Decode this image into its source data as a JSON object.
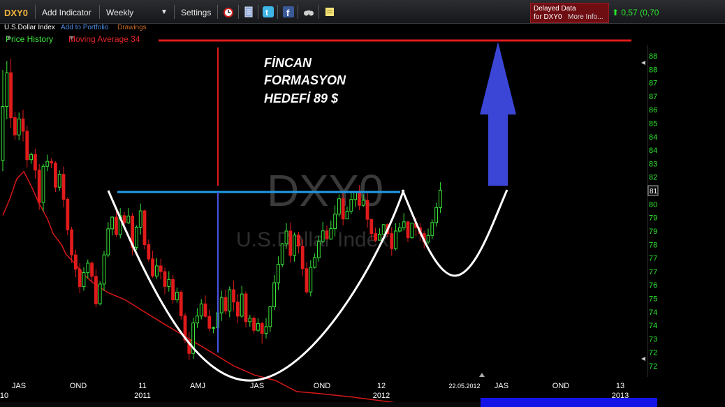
{
  "toolbar": {
    "symbol": "DXY0",
    "add_indicator": "Add Indicator",
    "period": "Weekly",
    "settings": "Settings",
    "delayed_line1": "Delayed Data",
    "delayed_line2": "for DXY0",
    "more_info": "More Info...",
    "price_change": "0,57 (0,70",
    "icons": [
      "alarm-clock-icon",
      "document-icon",
      "twitter-icon",
      "facebook-icon",
      "binoculars-icon",
      "note-icon"
    ]
  },
  "subbar": {
    "name": "U.S.Dollar Index",
    "add_to_portfolio": "Add to Portfolio",
    "drawings": "Drawings"
  },
  "legend": {
    "price_history": "Price History",
    "moving_average": "Moving Average 34"
  },
  "colors": {
    "up_candle": "#39e639",
    "down_candle": "#e01b1b",
    "moving_average": "#d81818",
    "annotation_blue": "#1e9ce8",
    "target_arrow": "#3b46d6",
    "target_line": "#e01b1b"
  },
  "annotation": {
    "line1": "FİNCAN",
    "line2": "FORMASYON",
    "line3": "HEDEFİ 89 $"
  },
  "watermark": {
    "symbol": "DXY0",
    "name": "U.S.Dollar Index"
  },
  "chart_data": {
    "type": "candlestick",
    "period": "weekly",
    "title": "",
    "y_ticks": [
      "88",
      "88",
      "87",
      "87",
      "86",
      "85",
      "84",
      "84",
      "83",
      "82",
      "81",
      "80",
      "79",
      "79",
      "78",
      "77",
      "77",
      "76",
      "75",
      "74",
      "74",
      "73",
      "72",
      "72"
    ],
    "current_value_label": "81",
    "x_ticks": [
      {
        "top": "JAS",
        "bottom": "10"
      },
      {
        "top": "OND",
        "bottom": ""
      },
      {
        "top": "11",
        "bottom": "2011"
      },
      {
        "top": "AMJ",
        "bottom": ""
      },
      {
        "top": "JAS",
        "bottom": ""
      },
      {
        "top": "OND",
        "bottom": ""
      },
      {
        "top": "12",
        "bottom": "2012"
      },
      {
        "top": "22.05.2012",
        "bottom": ""
      },
      {
        "top": "JAS",
        "bottom": ""
      },
      {
        "top": "OND",
        "bottom": ""
      },
      {
        "top": "13",
        "bottom": "2013"
      }
    ],
    "ylim": [
      71.6,
      88.8
    ],
    "grid": false,
    "candles": [
      [
        83.1,
        86.04,
        88.04,
        82.51
      ],
      [
        86.04,
        87.88,
        88.52,
        85.35
      ],
      [
        87.88,
        85.43,
        88.65,
        84.89
      ],
      [
        85.43,
        84.49,
        85.75,
        84.23
      ],
      [
        84.49,
        85.36,
        85.71,
        84.2
      ],
      [
        85.36,
        84.69,
        85.87,
        84.14
      ],
      [
        84.69,
        83.14,
        84.99,
        82.71
      ],
      [
        83.14,
        83.42,
        83.53,
        82.91
      ],
      [
        83.42,
        82.57,
        83.74,
        82.1
      ],
      [
        82.57,
        80.81,
        82.9,
        80.4
      ],
      [
        80.81,
        82.78,
        82.91,
        80.32
      ],
      [
        82.78,
        83.05,
        83.42,
        82.51
      ],
      [
        83.05,
        82.96,
        83.21,
        82.67
      ],
      [
        82.96,
        81.64,
        83.06,
        81.37
      ],
      [
        81.64,
        82.34,
        82.55,
        81.43
      ],
      [
        82.34,
        80.98,
        82.77,
        80.57
      ],
      [
        80.98,
        79.32,
        81.1,
        79.03
      ],
      [
        79.32,
        77.95,
        79.48,
        77.52
      ],
      [
        77.95,
        77.17,
        78.24,
        76.74
      ],
      [
        77.17,
        76.22,
        77.49,
        75.87
      ],
      [
        76.22,
        76.98,
        77.28,
        76.0
      ],
      [
        76.98,
        77.5,
        77.7,
        76.66
      ],
      [
        77.5,
        76.78,
        77.6,
        76.45
      ],
      [
        76.78,
        75.29,
        77.2,
        75.08
      ],
      [
        75.29,
        76.36,
        76.52,
        75.2
      ],
      [
        76.36,
        77.95,
        78.17,
        75.99
      ],
      [
        77.95,
        79.37,
        79.73,
        77.82
      ],
      [
        79.37,
        80.01,
        80.06,
        79.01
      ],
      [
        80.01,
        79.06,
        80.48,
        78.92
      ],
      [
        79.06,
        80.09,
        80.5,
        78.85
      ],
      [
        80.09,
        79.7,
        80.29,
        79.42
      ],
      [
        79.7,
        80.07,
        80.5,
        79.64
      ],
      [
        80.07,
        78.36,
        80.23,
        77.96
      ],
      [
        78.36,
        79.46,
        79.56,
        78.21
      ],
      [
        79.46,
        80.35,
        80.75,
        79.06
      ],
      [
        80.35,
        78.51,
        80.43,
        78.25
      ],
      [
        78.51,
        77.73,
        78.79,
        77.58
      ],
      [
        77.73,
        76.8,
        78.19,
        76.71
      ],
      [
        76.8,
        77.35,
        77.79,
        76.64
      ],
      [
        77.35,
        77.04,
        77.74,
        76.61
      ],
      [
        77.04,
        76.23,
        77.25,
        75.81
      ],
      [
        76.23,
        76.61,
        77.06,
        75.95
      ],
      [
        76.61,
        75.5,
        76.84,
        75.29
      ],
      [
        75.5,
        75.92,
        76.17,
        75.34
      ],
      [
        75.92,
        74.63,
        76.03,
        74.43
      ],
      [
        74.63,
        73.31,
        74.77,
        73.14
      ],
      [
        73.31,
        72.58,
        73.77,
        72.21
      ],
      [
        72.58,
        74.24,
        74.52,
        72.28
      ],
      [
        74.24,
        74.62,
        75.04,
        73.97
      ],
      [
        74.62,
        75.28,
        75.54,
        74.44
      ],
      [
        75.28,
        74.6,
        75.74,
        74.54
      ],
      [
        74.6,
        73.95,
        74.97,
        73.79
      ],
      [
        73.95,
        73.99,
        74.04,
        73.68
      ],
      [
        73.99,
        74.79,
        75.03,
        73.79
      ],
      [
        74.79,
        75.63,
        76.01,
        74.35
      ],
      [
        75.63,
        74.89,
        76.06,
        74.71
      ],
      [
        74.89,
        76.05,
        76.23,
        74.55
      ],
      [
        76.05,
        75.38,
        76.55,
        74.9
      ],
      [
        75.38,
        74.61,
        75.81,
        74.24
      ],
      [
        74.61,
        75.82,
        76.26,
        74.53
      ],
      [
        75.82,
        74.31,
        75.95,
        74.0
      ],
      [
        74.31,
        74.5,
        74.68,
        74.03
      ],
      [
        74.5,
        73.84,
        74.62,
        73.66
      ],
      [
        73.84,
        74.21,
        74.51,
        73.74
      ],
      [
        74.21,
        73.67,
        74.31,
        73.12
      ],
      [
        73.67,
        74.04,
        74.51,
        73.4
      ],
      [
        74.04,
        75.12,
        75.17,
        73.74
      ],
      [
        75.12,
        76.43,
        76.85,
        74.94
      ],
      [
        76.43,
        77.44,
        77.87,
        76.04
      ],
      [
        77.44,
        78.56,
        78.6,
        77.28
      ],
      [
        78.56,
        79.25,
        79.68,
        78.28
      ],
      [
        79.25,
        77.92,
        79.71,
        77.53
      ],
      [
        77.92,
        79.03,
        79.17,
        77.58
      ],
      [
        79.03,
        78.43,
        79.21,
        78.04
      ],
      [
        78.43,
        77.2,
        78.8,
        76.79
      ],
      [
        77.2,
        75.93,
        77.56,
        75.84
      ],
      [
        75.93,
        77.27,
        77.66,
        75.69
      ],
      [
        77.27,
        77.8,
        78.02,
        77.21
      ],
      [
        77.8,
        78.68,
        78.97,
        77.59
      ],
      [
        78.68,
        79.26,
        79.75,
        78.6
      ],
      [
        79.26,
        78.82,
        79.55,
        78.8
      ],
      [
        78.82,
        79.38,
        79.83,
        78.77
      ],
      [
        79.38,
        80.17,
        80.64,
        78.96
      ],
      [
        80.17,
        81.01,
        81.25,
        80.03
      ],
      [
        81.01,
        79.91,
        81.36,
        79.56
      ],
      [
        79.91,
        80.33,
        80.59,
        79.91
      ],
      [
        80.33,
        80.97,
        81.41,
        80.17
      ],
      [
        80.97,
        81.35,
        81.42,
        80.56
      ],
      [
        81.35,
        80.65,
        81.75,
        80.39
      ],
      [
        80.65,
        80.93,
        81.25,
        80.58
      ],
      [
        80.93,
        79.89,
        81.36,
        79.43
      ],
      [
        79.89,
        79.11,
        79.91,
        78.78
      ],
      [
        79.11,
        78.75,
        79.44,
        78.64
      ],
      [
        78.75,
        79.08,
        79.4,
        78.77
      ],
      [
        79.08,
        79.6,
        79.64,
        79.26
      ],
      [
        79.6,
        79.11,
        79.68,
        78.93
      ],
      [
        79.11,
        78.29,
        79.46,
        77.9
      ],
      [
        78.29,
        79.25,
        79.68,
        78.2
      ],
      [
        79.25,
        79.43,
        79.71,
        79.17
      ],
      [
        79.43,
        79.75,
        80.22,
        79.28
      ],
      [
        79.75,
        78.89,
        79.81,
        78.64
      ],
      [
        78.89,
        79.68,
        79.7,
        78.83
      ],
      [
        79.68,
        79.44,
        79.96,
        78.96
      ],
      [
        79.44,
        79.11,
        79.69,
        78.71
      ],
      [
        79.11,
        78.65,
        79.26,
        78.29
      ],
      [
        78.65,
        79.01,
        79.38,
        78.53
      ],
      [
        79.01,
        79.71,
        79.88,
        78.81
      ],
      [
        79.71,
        80.53,
        80.79,
        79.49
      ],
      [
        80.53,
        81.48,
        81.91,
        80.24
      ]
    ],
    "moving_average_34": [
      [
        0,
        80.1
      ],
      [
        10,
        81.0
      ],
      [
        20,
        82.1
      ],
      [
        30,
        82.5
      ],
      [
        42,
        81.6
      ],
      [
        50,
        80.9
      ],
      [
        57,
        80.4
      ],
      [
        64,
        79.9
      ],
      [
        72,
        79.1
      ],
      [
        84,
        78.5
      ],
      [
        90,
        78.0
      ],
      [
        105,
        77.4
      ],
      [
        115,
        76.9
      ],
      [
        130,
        76.4
      ],
      [
        150,
        75.9
      ],
      [
        175,
        75.5
      ],
      [
        200,
        74.9
      ],
      [
        230,
        74.2
      ],
      [
        265,
        73.4
      ],
      [
        300,
        72.6
      ],
      [
        330,
        71.9
      ],
      [
        360,
        71.4
      ],
      [
        390,
        71.1
      ],
      [
        420,
        70.5
      ],
      [
        450,
        70.4
      ],
      [
        500,
        70.2
      ],
      [
        540,
        70.0
      ],
      [
        600,
        69.7
      ],
      [
        660,
        69.5
      ]
    ]
  }
}
